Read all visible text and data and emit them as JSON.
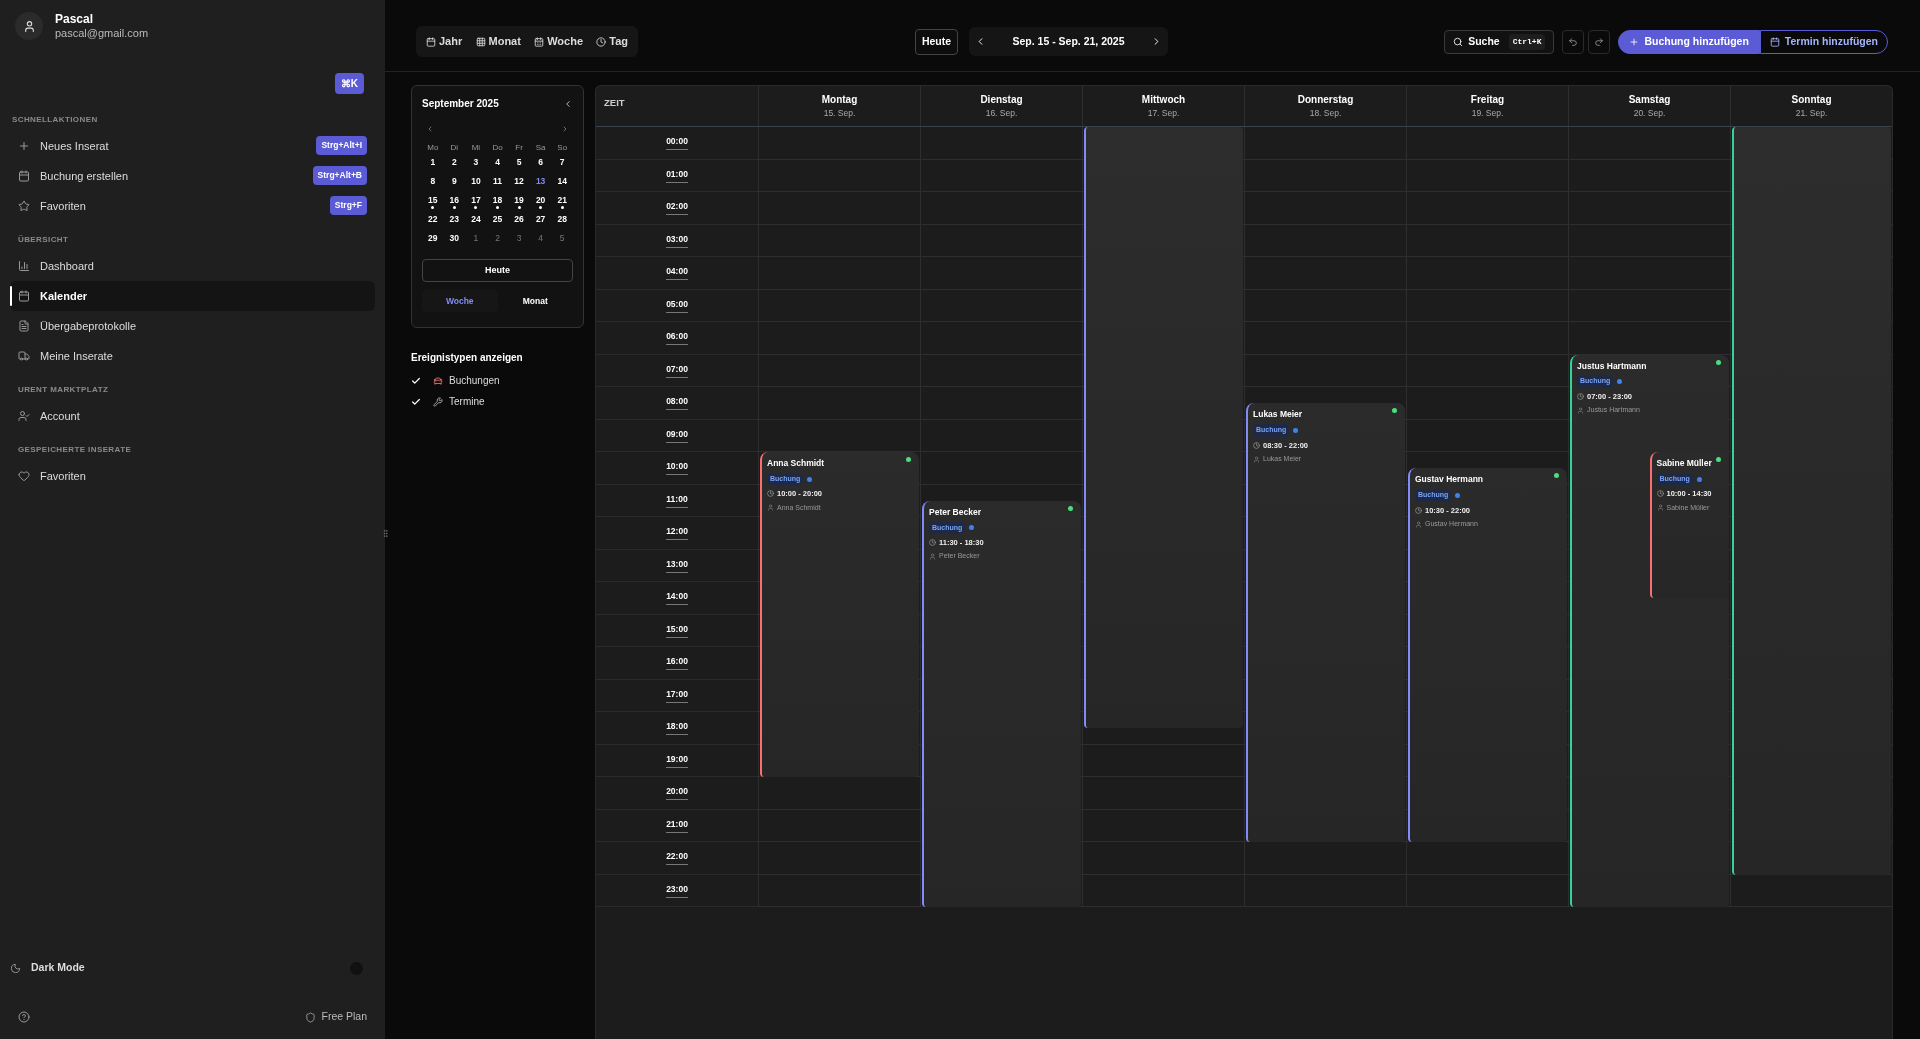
{
  "sidebar": {
    "user": {
      "name": "Pascal",
      "email": "pascal@gmail.com"
    },
    "command_shortcut": "⌘K",
    "sections": [
      {
        "title": "SCHNELLAKTIONEN",
        "items": [
          {
            "label": "Neues Inserat",
            "shortcut": "Strg+Alt+I",
            "selected": false
          },
          {
            "label": "Buchung erstellen",
            "shortcut": "Strg+Alt+B",
            "selected": false
          },
          {
            "label": "Favoriten",
            "shortcut": "Strg+F",
            "selected": false
          }
        ]
      },
      {
        "title": "ÜBERSICHT",
        "items": [
          {
            "label": "Dashboard",
            "selected": false
          },
          {
            "label": "Kalender",
            "selected": true
          },
          {
            "label": "Übergabeprotokolle",
            "selected": false
          },
          {
            "label": "Meine Inserate",
            "selected": false
          }
        ]
      },
      {
        "title": "URENT MARKTPLATZ",
        "items": [
          {
            "label": "Account",
            "selected": false
          }
        ]
      },
      {
        "title": "GESPEICHERTE INSERATE",
        "items": [
          {
            "label": "Favoriten",
            "selected": false
          }
        ]
      }
    ],
    "dark_mode": {
      "label": "Dark Mode",
      "on": false
    },
    "plan": "Free Plan"
  },
  "toolbar": {
    "view_tabs": [
      {
        "label": "Jahr",
        "selected": false
      },
      {
        "label": "Monat",
        "selected": false
      },
      {
        "label": "Woche",
        "selected": false
      },
      {
        "label": "Tag",
        "selected": false
      }
    ],
    "today_button": "Heute",
    "date_range": "Sep. 15 - Sep. 21, 2025",
    "search": {
      "label": "Suche",
      "shortcut": "Ctrl+K"
    },
    "actions": [
      {
        "label": "Buchung hinzufügen",
        "kind": "primary"
      },
      {
        "label": "Termin hinzufügen",
        "kind": "outline"
      }
    ]
  },
  "mini_calendar": {
    "title": "September 2025",
    "weekdays": [
      "Mo",
      "Di",
      "Mi",
      "Do",
      "Fr",
      "Sa",
      "So"
    ],
    "weeks": [
      [
        {
          "day": "1",
          "muted": false,
          "today": false,
          "dot": false
        },
        {
          "day": "2",
          "muted": false,
          "today": false,
          "dot": false
        },
        {
          "day": "3",
          "muted": false,
          "today": false,
          "dot": false
        },
        {
          "day": "4",
          "muted": false,
          "today": false,
          "dot": false
        },
        {
          "day": "5",
          "muted": false,
          "today": false,
          "dot": false
        },
        {
          "day": "6",
          "muted": false,
          "today": false,
          "dot": false
        },
        {
          "day": "7",
          "muted": false,
          "today": false,
          "dot": false
        }
      ],
      [
        {
          "day": "8",
          "muted": false,
          "today": false,
          "dot": false
        },
        {
          "day": "9",
          "muted": false,
          "today": false,
          "dot": false
        },
        {
          "day": "10",
          "muted": false,
          "today": false,
          "dot": false
        },
        {
          "day": "11",
          "muted": false,
          "today": false,
          "dot": false
        },
        {
          "day": "12",
          "muted": false,
          "today": false,
          "dot": false
        },
        {
          "day": "13",
          "muted": false,
          "today": true,
          "dot": false
        },
        {
          "day": "14",
          "muted": false,
          "today": false,
          "dot": false
        }
      ],
      [
        {
          "day": "15",
          "muted": false,
          "today": false,
          "dot": true
        },
        {
          "day": "16",
          "muted": false,
          "today": false,
          "dot": true
        },
        {
          "day": "17",
          "muted": false,
          "today": false,
          "dot": true
        },
        {
          "day": "18",
          "muted": false,
          "today": false,
          "dot": true
        },
        {
          "day": "19",
          "muted": false,
          "today": false,
          "dot": true
        },
        {
          "day": "20",
          "muted": false,
          "today": false,
          "dot": true
        },
        {
          "day": "21",
          "muted": false,
          "today": false,
          "dot": true
        }
      ],
      [
        {
          "day": "22",
          "muted": false,
          "today": false,
          "dot": false
        },
        {
          "day": "23",
          "muted": false,
          "today": false,
          "dot": false
        },
        {
          "day": "24",
          "muted": false,
          "today": false,
          "dot": false
        },
        {
          "day": "25",
          "muted": false,
          "today": false,
          "dot": false
        },
        {
          "day": "26",
          "muted": false,
          "today": false,
          "dot": false
        },
        {
          "day": "27",
          "muted": false,
          "today": false,
          "dot": false
        },
        {
          "day": "28",
          "muted": false,
          "today": false,
          "dot": false
        }
      ],
      [
        {
          "day": "29",
          "muted": false,
          "today": false,
          "dot": false
        },
        {
          "day": "30",
          "muted": false,
          "today": false,
          "dot": false
        },
        {
          "day": "1",
          "muted": true,
          "today": false,
          "dot": false
        },
        {
          "day": "2",
          "muted": true,
          "today": false,
          "dot": false
        },
        {
          "day": "3",
          "muted": true,
          "today": false,
          "dot": false
        },
        {
          "day": "4",
          "muted": true,
          "today": false,
          "dot": false
        },
        {
          "day": "5",
          "muted": true,
          "today": false,
          "dot": false
        }
      ]
    ],
    "today_button": "Heute",
    "views": [
      {
        "label": "Woche",
        "selected": true
      },
      {
        "label": "Monat",
        "selected": false
      }
    ]
  },
  "filters": {
    "title": "Ereignistypen anzeigen",
    "items": [
      {
        "label": "Buchungen",
        "checked": true
      },
      {
        "label": "Termine",
        "checked": true
      }
    ]
  },
  "calendar": {
    "time_heading": "ZEIT",
    "hours": [
      "00:00",
      "01:00",
      "02:00",
      "03:00",
      "04:00",
      "05:00",
      "06:00",
      "07:00",
      "08:00",
      "09:00",
      "10:00",
      "11:00",
      "12:00",
      "13:00",
      "14:00",
      "15:00",
      "16:00",
      "17:00",
      "18:00",
      "19:00",
      "20:00",
      "21:00",
      "22:00",
      "23:00"
    ],
    "days": [
      {
        "name": "Montag",
        "date": "15. Sep.",
        "events": [
          {
            "kind": "booking",
            "title": "Anna Schmidt",
            "badge": "Buchung",
            "time": "10:00 - 20:00",
            "person": "Anna Schmidt",
            "color": "#f87171",
            "multi_day": false
          }
        ]
      },
      {
        "name": "Dienstag",
        "date": "16. Sep.",
        "events": [
          {
            "kind": "booking",
            "title": "Peter Becker",
            "badge": "Buchung",
            "time": "11:30 - 18:30",
            "person": "Peter Becker",
            "color": "#818cf8",
            "multi_day": true
          }
        ]
      },
      {
        "name": "Mittwoch",
        "date": "17. Sep."
      },
      {
        "name": "Donnerstag",
        "date": "18. Sep.",
        "events": [
          {
            "kind": "booking",
            "title": "Lukas Meier",
            "badge": "Buchung",
            "time": "08:30 - 22:00",
            "person": "Lukas Meier",
            "color": "#818cf8",
            "multi_day": false
          }
        ]
      },
      {
        "name": "Freitag",
        "date": "19. Sep.",
        "events": [
          {
            "kind": "booking",
            "title": "Gustav Hermann",
            "badge": "Buchung",
            "time": "10:30 - 22:00",
            "person": "Gustav Hermann",
            "color": "#818cf8",
            "multi_day": false
          }
        ]
      },
      {
        "name": "Samstag",
        "date": "20. Sep.",
        "events": [
          {
            "kind": "booking",
            "title": "Justus Hartmann",
            "badge": "Buchung",
            "time": "07:00 - 23:00",
            "person": "Justus Hartmann",
            "color": "#34d399",
            "multi_day": true
          },
          {
            "kind": "booking",
            "title": "Sabine Müller",
            "badge": "Buchung",
            "time": "10:00 - 14:30",
            "person": "Sabine Müller",
            "color": "#f87171",
            "multi_day": false
          }
        ]
      },
      {
        "name": "Sonntag",
        "date": "21. Sep."
      }
    ]
  }
}
